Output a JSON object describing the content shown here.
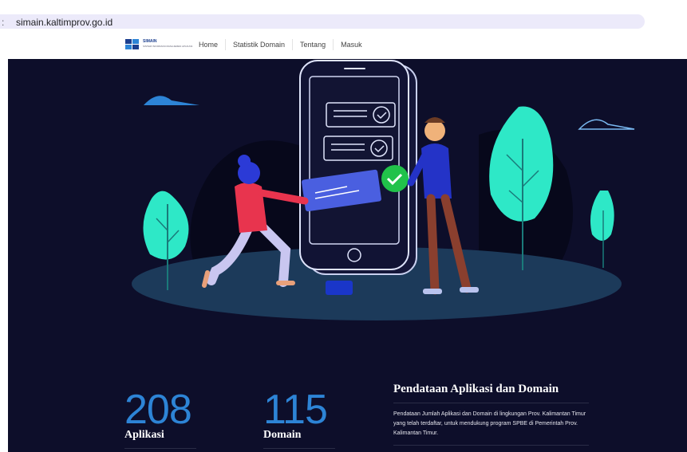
{
  "browser": {
    "url": "simain.kaltimprov.go.id"
  },
  "navbar": {
    "logo_title": "SIMAIN",
    "logo_subtitle": "SISTEM INFORMASI MANAJEMEN APLIKASI",
    "links": [
      "Home",
      "Statistik Domain",
      "Tentang",
      "Masuk"
    ]
  },
  "stats": [
    {
      "value": "208",
      "label": "Aplikasi"
    },
    {
      "value": "115",
      "label": "Domain"
    }
  ],
  "info": {
    "heading": "Pendataan Aplikasi dan Domain",
    "body": "Pendataan Jumlah Aplikasi dan Domain di lingkungan Prov. Kalimantan Timur yang telah terdaftar, untuk mendukung program SPBE di Pemerintah Prov. Kalimantan Timur."
  },
  "colors": {
    "hero_bg": "#0d0e2a",
    "accent_blue": "#2d84d6",
    "illustration_teal": "#2ee8c7",
    "check_green": "#21c24a"
  }
}
